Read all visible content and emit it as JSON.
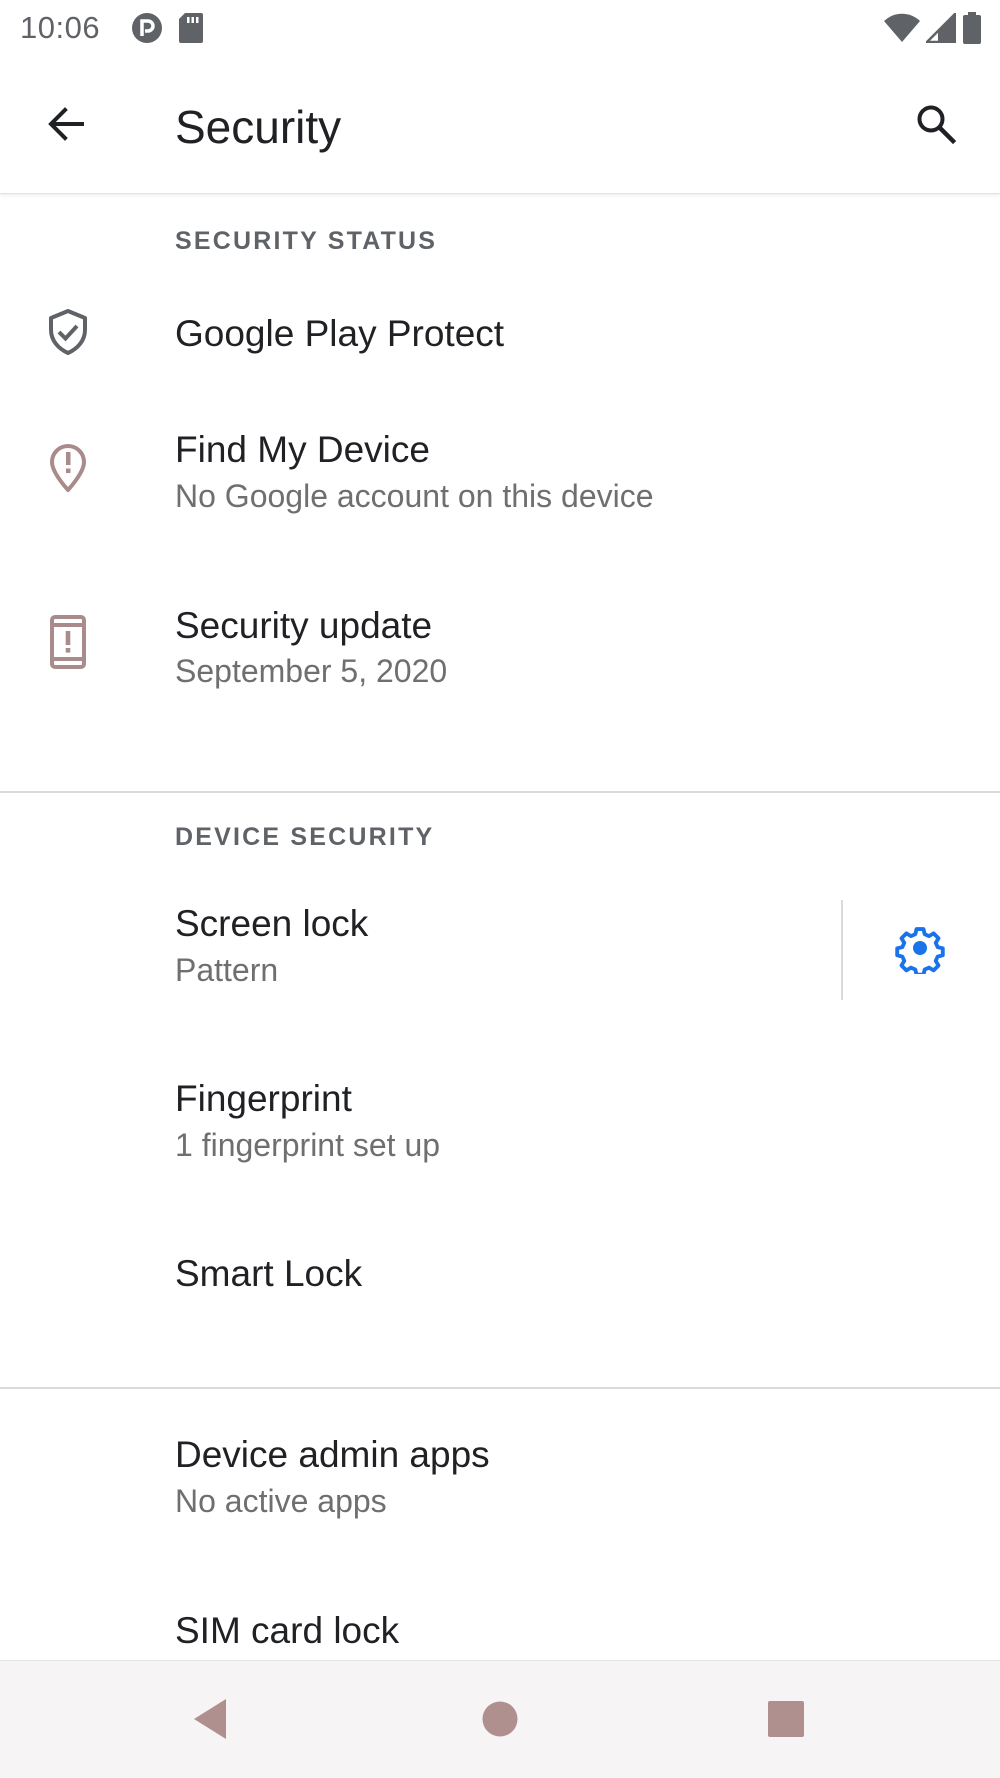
{
  "status_bar": {
    "time": "10:06",
    "icons_left": [
      "app-notification-icon",
      "sd-card-icon"
    ],
    "icons_right": [
      "wifi-icon",
      "cell-signal-icon",
      "battery-icon"
    ]
  },
  "app_bar": {
    "title": "Security",
    "back_icon": "arrow-back-icon",
    "search_icon": "search-icon"
  },
  "sections": {
    "security_status": {
      "header": "SECURITY STATUS",
      "items": [
        {
          "title": "Google Play Protect",
          "subtitle": "",
          "icon": "shield-check-icon"
        },
        {
          "title": "Find My Device",
          "subtitle": "No Google account on this device",
          "icon": "location-alert-icon"
        },
        {
          "title": "Security update",
          "subtitle": "September 5, 2020",
          "icon": "phone-alert-icon"
        }
      ]
    },
    "device_security": {
      "header": "DEVICE SECURITY",
      "items": [
        {
          "title": "Screen lock",
          "subtitle": "Pattern",
          "action_icon": "gear-icon"
        },
        {
          "title": "Fingerprint",
          "subtitle": "1 fingerprint set up"
        },
        {
          "title": "Smart Lock",
          "subtitle": ""
        }
      ]
    },
    "other": {
      "items": [
        {
          "title": "Device admin apps",
          "subtitle": "No active apps"
        },
        {
          "title": "SIM card lock",
          "subtitle": ""
        }
      ]
    }
  },
  "nav_bar": {
    "buttons": [
      "back-triangle-icon",
      "home-circle-icon",
      "recents-square-icon"
    ]
  },
  "colors": {
    "accent": "#1a73e8",
    "icon_tint": "#a98b8b",
    "nav_button": "#b08f8f",
    "secondary_text": "#6f6f6f"
  }
}
